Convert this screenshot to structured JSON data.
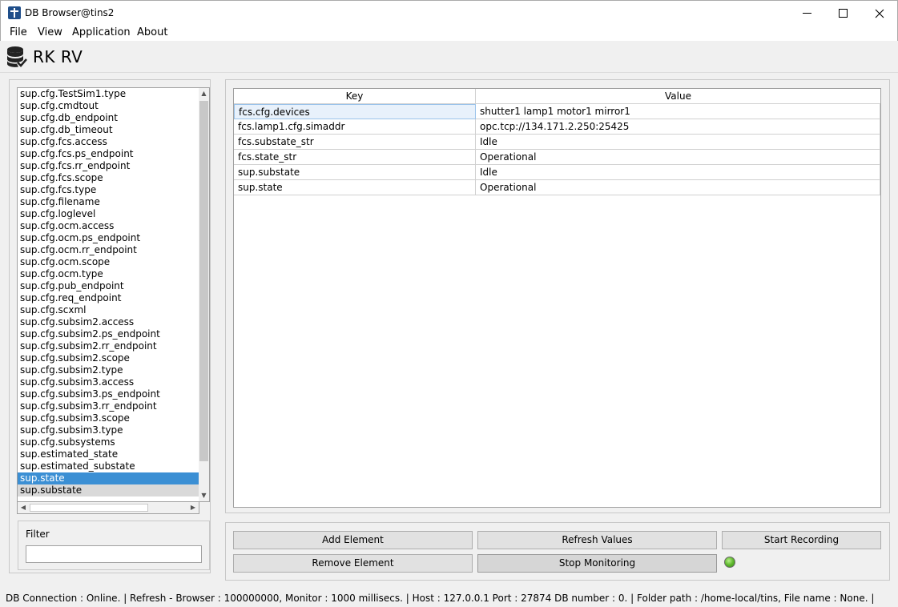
{
  "window": {
    "title": "DB Browser@tins2",
    "icon": "db-browser-app-icon",
    "controls": [
      "minimize-icon",
      "maximize-icon",
      "close-icon"
    ]
  },
  "menu": {
    "file": "File",
    "view": "View",
    "application": "Application",
    "about": "About"
  },
  "toolbar": {
    "icon": "database-check-icon",
    "title": "RK RV"
  },
  "keylist": {
    "items": [
      "sup.cfg.TestSim1.type",
      "sup.cfg.cmdtout",
      "sup.cfg.db_endpoint",
      "sup.cfg.db_timeout",
      "sup.cfg.fcs.access",
      "sup.cfg.fcs.ps_endpoint",
      "sup.cfg.fcs.rr_endpoint",
      "sup.cfg.fcs.scope",
      "sup.cfg.fcs.type",
      "sup.cfg.filename",
      "sup.cfg.loglevel",
      "sup.cfg.ocm.access",
      "sup.cfg.ocm.ps_endpoint",
      "sup.cfg.ocm.rr_endpoint",
      "sup.cfg.ocm.scope",
      "sup.cfg.ocm.type",
      "sup.cfg.pub_endpoint",
      "sup.cfg.req_endpoint",
      "sup.cfg.scxml",
      "sup.cfg.subsim2.access",
      "sup.cfg.subsim2.ps_endpoint",
      "sup.cfg.subsim2.rr_endpoint",
      "sup.cfg.subsim2.scope",
      "sup.cfg.subsim2.type",
      "sup.cfg.subsim3.access",
      "sup.cfg.subsim3.ps_endpoint",
      "sup.cfg.subsim3.rr_endpoint",
      "sup.cfg.subsim3.scope",
      "sup.cfg.subsim3.type",
      "sup.cfg.subsystems",
      "sup.estimated_state",
      "sup.estimated_substate",
      "sup.state",
      "sup.substate"
    ],
    "selected": "sup.state",
    "hovered": "sup.substate"
  },
  "filter": {
    "label": "Filter",
    "value": ""
  },
  "table": {
    "headers": {
      "key": "Key",
      "value": "Value"
    },
    "rows": [
      {
        "key": "fcs.cfg.devices",
        "value": "shutter1 lamp1 motor1 mirror1"
      },
      {
        "key": "fcs.lamp1.cfg.simaddr",
        "value": "opc.tcp://134.171.2.250:25425"
      },
      {
        "key": "fcs.substate_str",
        "value": "Idle"
      },
      {
        "key": "fcs.state_str",
        "value": "Operational"
      },
      {
        "key": "sup.substate",
        "value": "Idle"
      },
      {
        "key": "sup.state",
        "value": "Operational"
      }
    ]
  },
  "buttons": {
    "add_element": "Add Element",
    "refresh_values": "Refresh Values",
    "start_recording": "Start Recording",
    "remove_element": "Remove Element",
    "stop_monitoring": "Stop Monitoring"
  },
  "monitor_led": {
    "state": "on",
    "color": "#5fb82e"
  },
  "status": {
    "text": "DB Connection : Online.  | Refresh - Browser : 100000000, Monitor : 1000 millisecs.  | Host : 127.0.0.1 Port : 27874 DB number : 0. | Folder path : /home-local/tins, File name : None. |"
  }
}
